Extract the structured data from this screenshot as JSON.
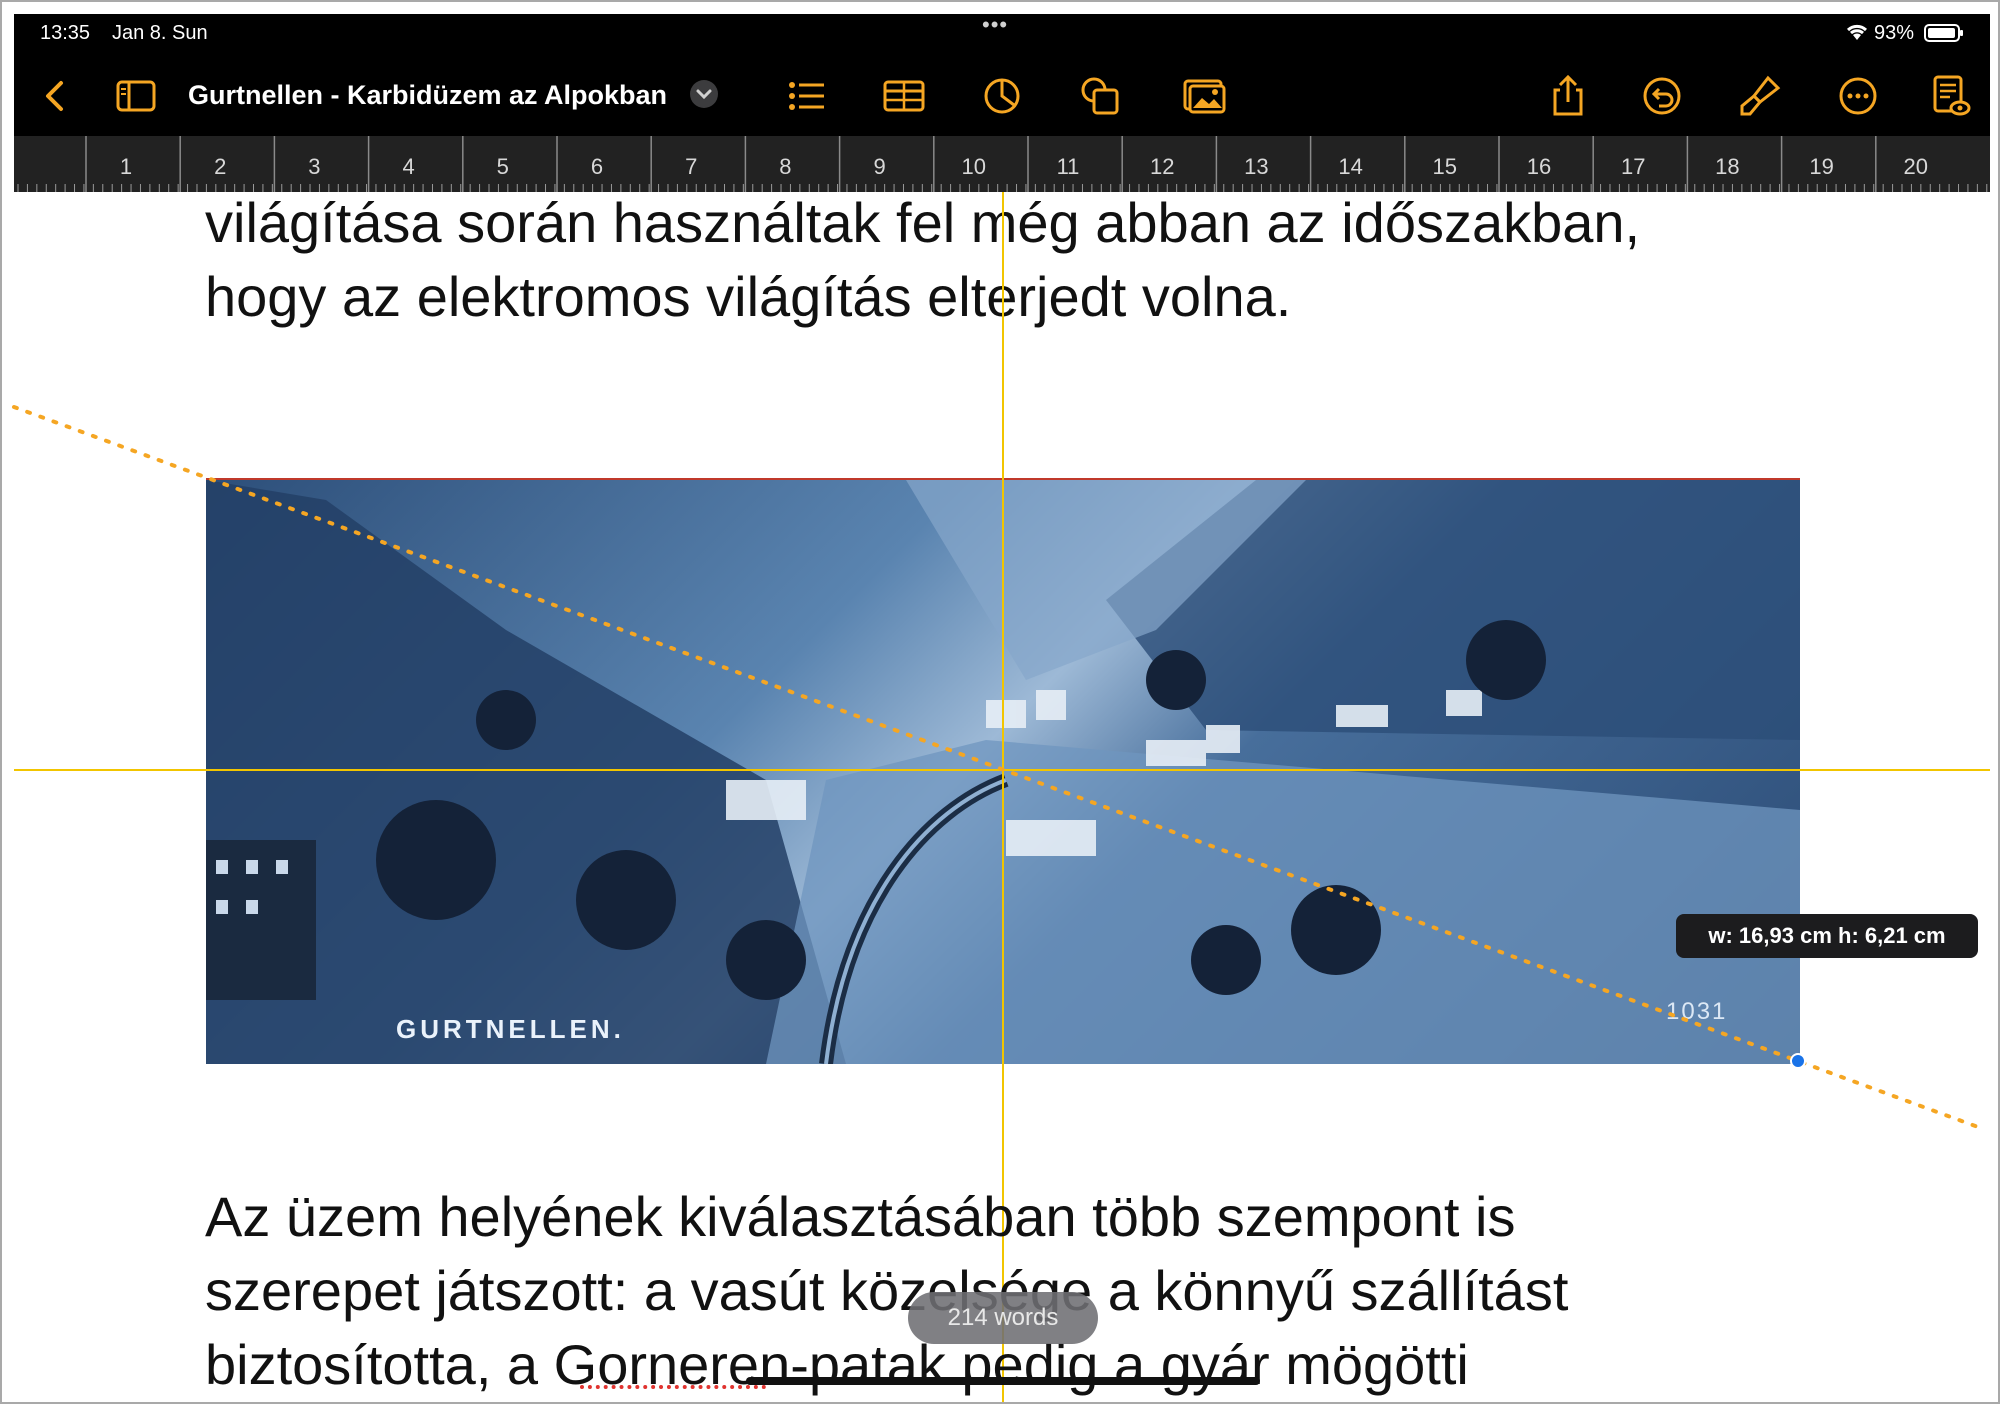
{
  "status_bar": {
    "time": "13:35",
    "date": "Jan 8. Sun",
    "battery_percent": "93%"
  },
  "toolbar": {
    "doc_title": "Gurtnellen - Karbidüzem az Alpokban",
    "icons": [
      "back-chevron",
      "sidebar-toggle",
      "title-dropdown",
      "list-format",
      "insert-table",
      "insert-chart",
      "insert-shape",
      "insert-media",
      "share",
      "undo",
      "format-brush",
      "more",
      "document-view"
    ]
  },
  "ruler": {
    "numbers": [
      "1",
      "2",
      "3",
      "4",
      "5",
      "6",
      "7",
      "8",
      "9",
      "10",
      "11",
      "12",
      "13",
      "14",
      "15",
      "16",
      "17",
      "18",
      "19",
      "20"
    ]
  },
  "document": {
    "para_top_line1": "világítása során használtak fel még abban az időszakban,",
    "para_top_line2": "hogy az elektromos világítás elterjedt volna.",
    "image_caption": "GURTNELLEN.",
    "image_number": "1031",
    "para_bottom_line1": "Az üzem helyének kiválasztásában több szempont is",
    "para_bottom_line2": "szerepet játszott: a vasút közelsége a könnyű szállítást",
    "para_bottom_line3": "biztosította, a Gorneren-patak pedig a gyár mögötti"
  },
  "selection": {
    "dimensions": "w: 16,93 cm  h: 6,21 cm"
  },
  "word_count": "214 words",
  "colors": {
    "accent": "#f5a623",
    "guide": "#f2c500",
    "handle": "#1a73e8",
    "spellcheck": "#e0332f"
  }
}
